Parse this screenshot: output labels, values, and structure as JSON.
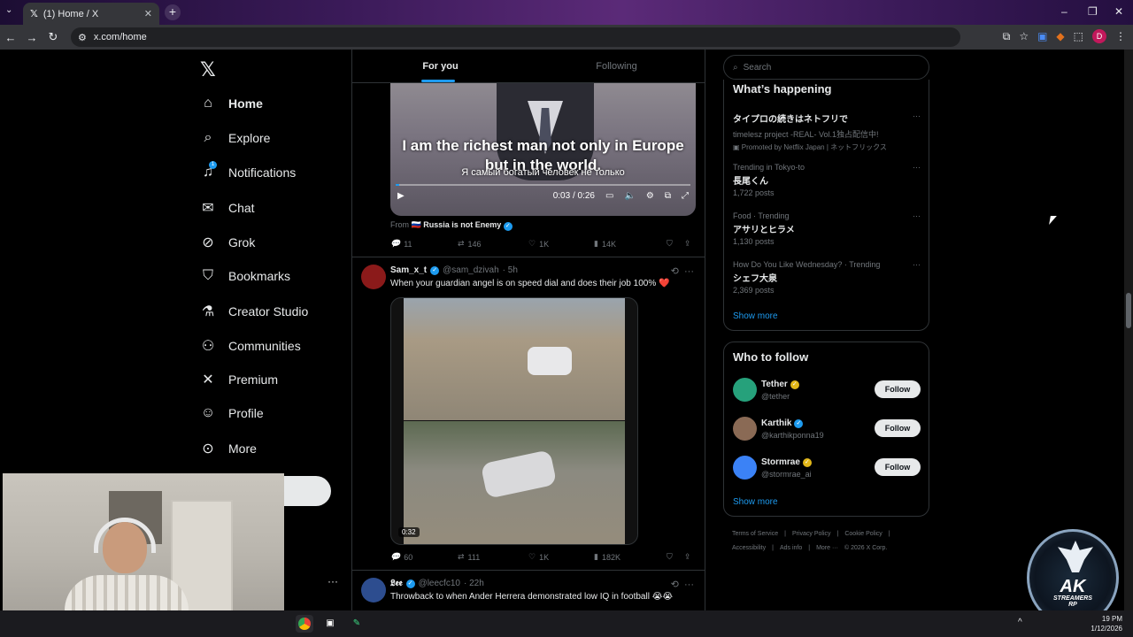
{
  "browser": {
    "tab_title": "(1) Home / X",
    "url": "x.com/home"
  },
  "nav": {
    "items": [
      {
        "label": "Home",
        "icon": "home-icon"
      },
      {
        "label": "Explore",
        "icon": "search-icon"
      },
      {
        "label": "Notifications",
        "icon": "bell-icon",
        "badge": "1"
      },
      {
        "label": "Chat",
        "icon": "mail-icon"
      },
      {
        "label": "Grok",
        "icon": "grok-icon"
      },
      {
        "label": "Bookmarks",
        "icon": "bookmark-icon"
      },
      {
        "label": "Creator Studio",
        "icon": "flask-icon"
      },
      {
        "label": "Communities",
        "icon": "people-icon"
      },
      {
        "label": "Premium",
        "icon": "x-icon"
      },
      {
        "label": "Profile",
        "icon": "person-icon"
      },
      {
        "label": "More",
        "icon": "more-circle-icon"
      }
    ]
  },
  "feed": {
    "tabs": [
      "For you",
      "Following"
    ],
    "post1": {
      "caption_en": "I am the richest man not only in Europe but in the world.",
      "caption_ru": "Я самый богатый человек не только",
      "time": "0:03 / 0:26",
      "from_prefix": "From",
      "from_name": "Russia is not Enemy",
      "replies": "11",
      "reposts": "146",
      "likes": "1K",
      "views": "14K"
    },
    "post2": {
      "name": "Sam_x_t",
      "handle": "@sam_dzivah",
      "age": "· 5h",
      "text": "When your guardian angel is on speed dial and does their job 100% ❤️",
      "duration": "0:32",
      "replies": "60",
      "reposts": "111",
      "likes": "1K",
      "views": "182K"
    },
    "post3": {
      "name": "𝕷𝖊𝖊",
      "handle": "@leecfc10",
      "age": "· 22h",
      "text": "Throwback to when Ander Herrera demonstrated low IQ in football 😭😭"
    }
  },
  "sidebar": {
    "search_placeholder": "Search",
    "happening_title": "What’s happening",
    "trends": [
      {
        "kind": "promo",
        "title": "タイプロの続きはネトフリで",
        "line2": "timelesz project -REAL- Vol.1独占配信中!",
        "line3": "Promoted by Netflix Japan | ネットフリックス"
      },
      {
        "kind": "trend",
        "context": "Trending in Tokyo-to",
        "title": "長尾くん",
        "posts": "1,722 posts"
      },
      {
        "kind": "trend",
        "context": "Food · Trending",
        "title": "アサリとヒラメ",
        "posts": "1,130 posts"
      },
      {
        "kind": "trend",
        "context": "How Do You Like Wednesday? · Trending",
        "title": "シェフ大泉",
        "posts": "2,369 posts"
      }
    ],
    "show_more": "Show more",
    "who_title": "Who to follow",
    "follow": [
      {
        "name": "Tether",
        "handle": "@tether",
        "badge_color": "#e2b719",
        "avatar_color": "#26a17b"
      },
      {
        "name": "Karthik",
        "handle": "@karthikponna19",
        "badge_color": "#1d9bf0",
        "avatar_color": "#8a6a55"
      },
      {
        "name": "Stormrae",
        "handle": "@stormrae_ai",
        "badge_color": "#e2b719",
        "avatar_color": "#3b82f6"
      }
    ],
    "follow_label": "Follow",
    "footer": [
      "Terms of Service",
      "|",
      "Privacy Policy",
      "|",
      "Cookie Policy",
      "|",
      "Accessibility",
      "|",
      "Ads info",
      "|",
      "More ···",
      "© 2026 X Corp."
    ]
  },
  "overlay": {
    "logo_main": "AK",
    "logo_sub1": "STREAMERS",
    "logo_sub2": "RP"
  },
  "taskbar": {
    "time": "19 PM",
    "date": "1/12/2026"
  },
  "colors": {
    "accent": "#1d9bf0",
    "bg": "#000000",
    "border": "#2f3336"
  }
}
